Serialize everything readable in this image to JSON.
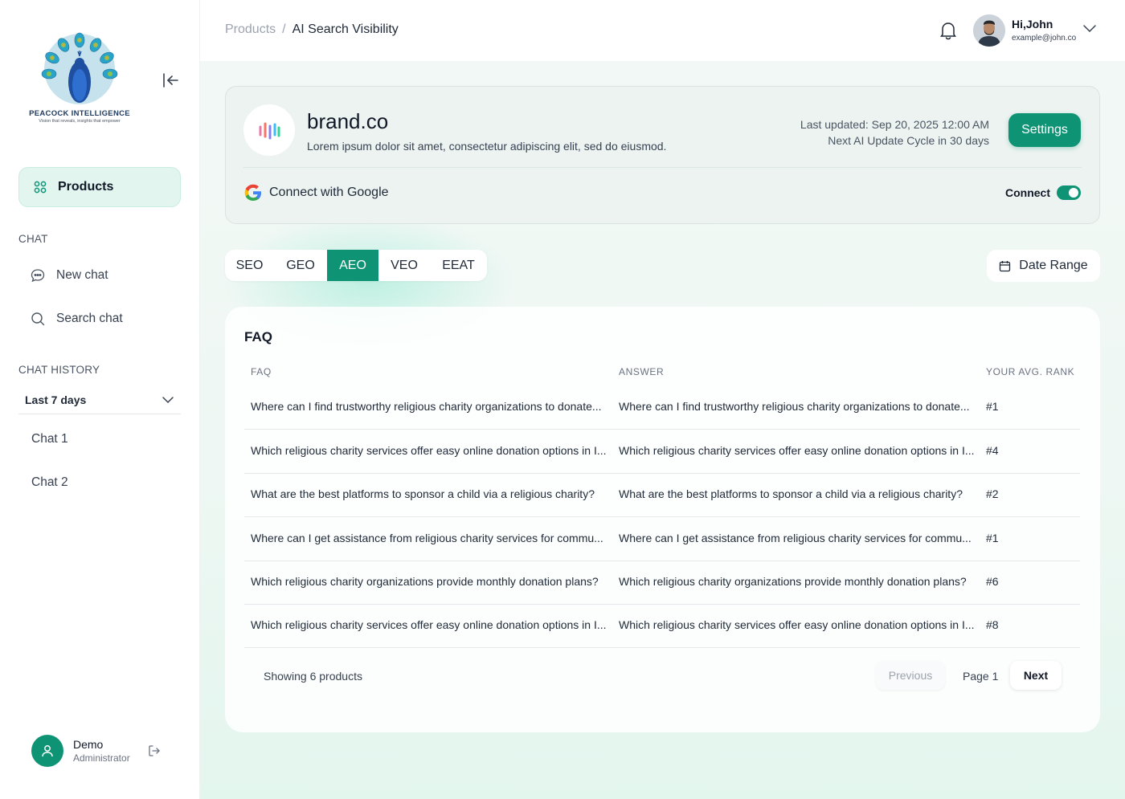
{
  "sidebar": {
    "logo": {
      "brand": "PEACOCK INTELLIGENCE",
      "tagline": "Vision that reveals, insights that empower"
    },
    "nav": {
      "products_label": "Products"
    },
    "chat_section_label": "CHAT",
    "new_chat_label": "New chat",
    "search_chat_label": "Search chat",
    "history_section_label": "CHAT HISTORY",
    "history_filter": "Last 7 days",
    "chats": [
      "Chat 1",
      "Chat 2"
    ],
    "user": {
      "name": "Demo",
      "role": "Administrator"
    }
  },
  "topbar": {
    "breadcrumb": {
      "parent": "Products",
      "separator": "/",
      "current": "AI Search Visibility"
    },
    "profile": {
      "greeting": "Hi,John",
      "email": "example@john.co"
    }
  },
  "brand_card": {
    "name": "brand.co",
    "description": "Lorem ipsum dolor sit amet, consectetur adipiscing elit, sed do eiusmod.",
    "last_updated": "Last updated: Sep 20, 2025 12:00 AM",
    "next_cycle": "Next AI Update Cycle in 30 days",
    "settings_label": "Settings",
    "google_label": "Connect with Google",
    "connect_label": "Connect",
    "connect_enabled": true
  },
  "tabs": [
    {
      "label": "SEO",
      "active": false
    },
    {
      "label": "GEO",
      "active": false
    },
    {
      "label": "AEO",
      "active": true
    },
    {
      "label": "VEO",
      "active": false
    },
    {
      "label": "EEAT",
      "active": false
    }
  ],
  "date_range_label": "Date Range",
  "faq": {
    "title": "FAQ",
    "columns": [
      "FAQ",
      "ANSWER",
      "YOUR AVG. RANK"
    ],
    "rows": [
      {
        "faq": "Where can I find trustworthy religious charity organizations to donate...",
        "answer": "Where can I find trustworthy religious charity organizations to donate...",
        "rank": "#1"
      },
      {
        "faq": "Which religious charity services offer easy online donation options in I...",
        "answer": "Which religious charity services offer easy online donation options in I...",
        "rank": "#4"
      },
      {
        "faq": "What are the best platforms to sponsor a child via a religious charity?",
        "answer": "What are the best platforms to sponsor a child via a religious charity?",
        "rank": "#2"
      },
      {
        "faq": "Where can I get assistance from religious charity services for commu...",
        "answer": "Where can I get assistance from religious charity services for commu...",
        "rank": "#1"
      },
      {
        "faq": "Which religious charity organizations provide monthly donation plans?",
        "answer": "Which religious charity organizations provide monthly donation plans?",
        "rank": "#6"
      },
      {
        "faq": "Which religious charity services offer easy online donation options in I...",
        "answer": "Which religious charity services offer easy online donation options in I...",
        "rank": "#8"
      }
    ],
    "showing": "Showing 6 products",
    "pagination": {
      "previous": "Previous",
      "page": "Page 1",
      "next": "Next"
    }
  },
  "colors": {
    "accent": "#0e9474",
    "accent_light": "#e2f5ef"
  },
  "icons": [
    "collapse-icon",
    "grid-icon",
    "chat-bubble-icon",
    "search-icon",
    "chevron-down-icon",
    "logout-icon",
    "bell-icon",
    "google-icon",
    "calendar-icon",
    "user-icon"
  ]
}
